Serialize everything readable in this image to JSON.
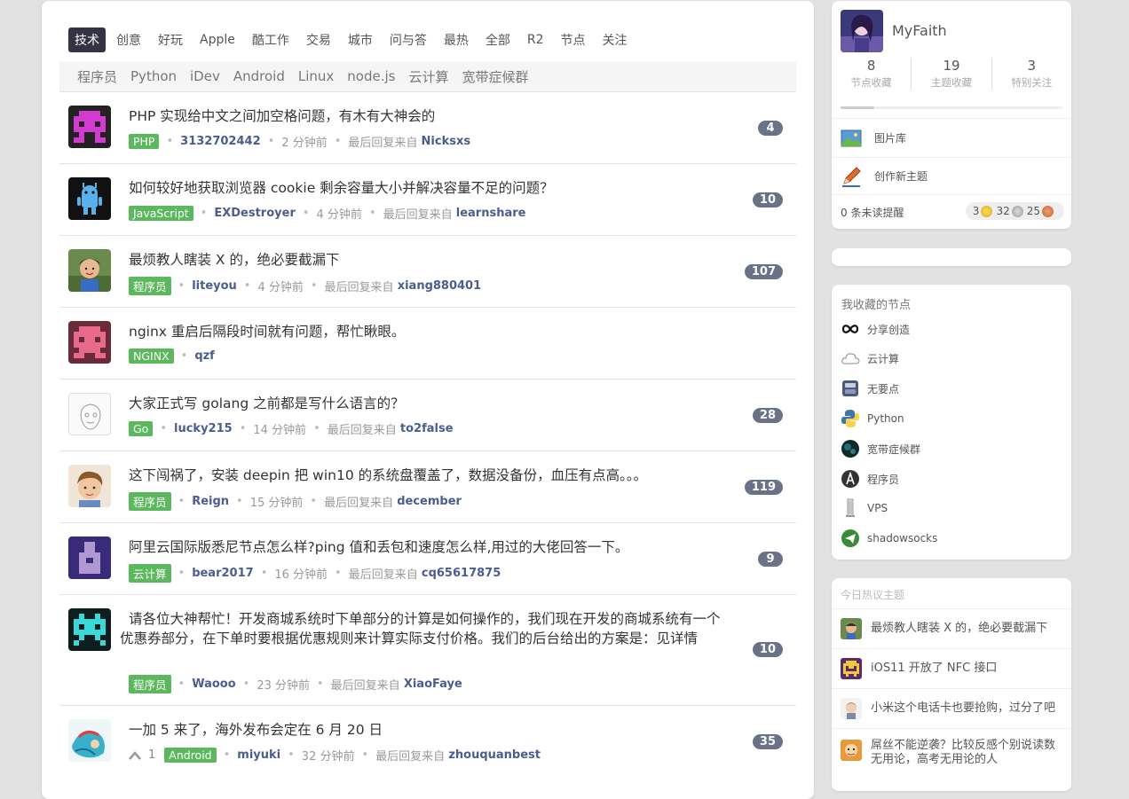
{
  "tabs": [
    "技术",
    "创意",
    "好玩",
    "Apple",
    "酷工作",
    "交易",
    "城市",
    "问与答",
    "最热",
    "全部",
    "R2",
    "节点",
    "关注"
  ],
  "subtabs": [
    "程序员",
    "Python",
    "iDev",
    "Android",
    "Linux",
    "node.js",
    "云计算",
    "宽带症候群"
  ],
  "topics": [
    {
      "title": "PHP 实现给中文之间加空格问题，有木有大神会的",
      "node": "PHP",
      "user": "3132702442",
      "time": "2 分钟前",
      "reply_label": "最后回复来自",
      "last": "Nicksxs",
      "count": "4",
      "node_color": "#5cb85c"
    },
    {
      "title": "如何较好地获取浏览器 cookie 剩余容量大小并解决容量不足的问题？",
      "node": "JavaScript",
      "user": "EXDestroyer",
      "time": "4 分钟前",
      "reply_label": "最后回复来自",
      "last": "learnshare",
      "count": "10",
      "node_color": "#5cb85c"
    },
    {
      "title": "最烦教人瞎装 X 的，绝必要截漏下",
      "node": "程序员",
      "user": "liteyou",
      "time": "4 分钟前",
      "reply_label": "最后回复来自",
      "last": "xiang880401",
      "count": "107",
      "node_color": "#5cb85c"
    },
    {
      "title": "nginx 重启后隔段时间就有问题，帮忙瞅眼。",
      "node": "NGINX",
      "user": "qzf",
      "time": "",
      "reply_label": "",
      "last": "",
      "count": "",
      "node_color": "#5cb85c"
    },
    {
      "title": "大家正式写 golang 之前都是写什么语言的？",
      "node": "Go",
      "user": "lucky215",
      "time": "14 分钟前",
      "reply_label": "最后回复来自",
      "last": "to2false",
      "count": "28",
      "node_color": "#5cb85c"
    },
    {
      "title": "这下闯祸了，安装 deepin 把 win10 的系统盘覆盖了，数据没备份，血压有点高。。。",
      "node": "程序员",
      "user": "Reign",
      "time": "15 分钟前",
      "reply_label": "最后回复来自",
      "last": "december",
      "count": "119",
      "node_color": "#5cb85c"
    },
    {
      "title": "阿里云国际版悉尼节点怎么样?ping 值和丢包和速度怎么样,用过的大佬回答一下。",
      "node": "云计算",
      "user": "bear2017",
      "time": "16 分钟前",
      "reply_label": "最后回复来自",
      "last": "cq65617875",
      "count": "9",
      "node_color": "#5cb85c"
    },
    {
      "title": "请各位大神帮忙！开发商城系统时下单部分的计算是如何操作的，我们现在开发的商城系统有一个优惠券部分，在下单时要根据优惠规则来计算实际支付价格。我们的后台给出的方案是：见详情",
      "node": "程序员",
      "user": "Waooo",
      "time": "23 分钟前",
      "reply_label": "最后回复来自",
      "last": "XiaoFaye",
      "count": "10",
      "node_color": "#5cb85c"
    },
    {
      "title": "一加 5 来了，海外发布会定在 6 月 20 日",
      "node": "Android",
      "user": "miyuki",
      "time": "32 分钟前",
      "reply_label": "最后回复来自",
      "last": "zhouquanbest",
      "count": "35",
      "upvotes": "1",
      "node_color": "#5cb85c"
    }
  ],
  "profile": {
    "username": "MyFaith",
    "stats": [
      {
        "n": "8",
        "l": "节点收藏"
      },
      {
        "n": "19",
        "l": "主题收藏"
      },
      {
        "n": "3",
        "l": "特别关注"
      }
    ],
    "progress": 0.15,
    "gallery_label": "图片库",
    "new_topic_label": "创作新主题",
    "notifications_label": "0 条未读提醒",
    "coins": {
      "gold": "3",
      "silver": "32",
      "bronze": "25"
    }
  },
  "favorites": {
    "title": "我收藏的节点",
    "items": [
      {
        "label": "分享创造",
        "icon": "infinity-icon"
      },
      {
        "label": "云计算",
        "icon": "cloud-icon"
      },
      {
        "label": "无要点",
        "icon": "server-icon"
      },
      {
        "label": "Python",
        "icon": "python-icon"
      },
      {
        "label": "宽带症候群",
        "icon": "globe-icon"
      },
      {
        "label": "程序员",
        "icon": "programmer-icon"
      },
      {
        "label": "VPS",
        "icon": "vps-icon"
      },
      {
        "label": "shadowsocks",
        "icon": "paper-plane-icon"
      }
    ]
  },
  "hot": {
    "title": "今日热议主题",
    "items": [
      {
        "title": "最烦教人瞎装 X 的，绝必要截漏下"
      },
      {
        "title": "iOS11 开放了 NFC 接口"
      },
      {
        "title": "小米这个电话卡也要抢购，过分了吧"
      },
      {
        "title": "屌丝不能逆袭？比较反感个别说读数无用论，高考无用论的人"
      }
    ]
  },
  "colors": {
    "active_tab": "#334455",
    "node_bg": "#5cb85c",
    "count_bg": "#6a7288",
    "user_link": "#4a5d8e"
  }
}
